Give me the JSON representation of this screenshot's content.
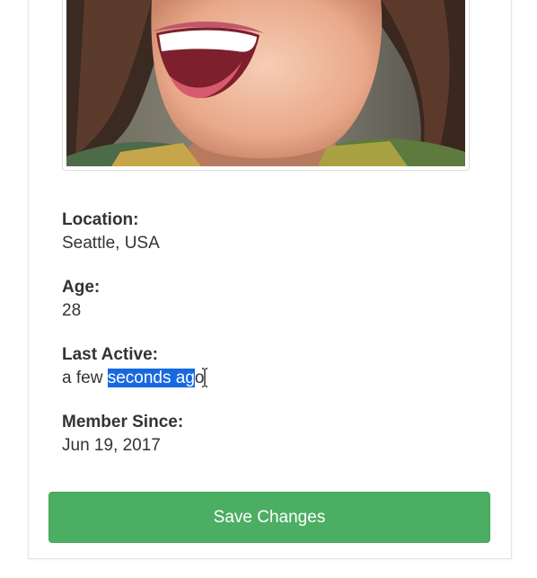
{
  "profile": {
    "photo_alt": "member photo",
    "fields": [
      {
        "label": "Location:",
        "value": "Seattle, USA"
      },
      {
        "label": "Age:",
        "value": "28"
      },
      {
        "label": "Last Active:",
        "value_prefix": "a few ",
        "value_selected": "seconds ag",
        "value_suffix": "o"
      },
      {
        "label": "Member Since:",
        "value": "Jun 19, 2017"
      }
    ]
  },
  "actions": {
    "save_label": "Save Changes"
  },
  "colors": {
    "save_button": "#4cae63",
    "selection": "#1769e0"
  }
}
